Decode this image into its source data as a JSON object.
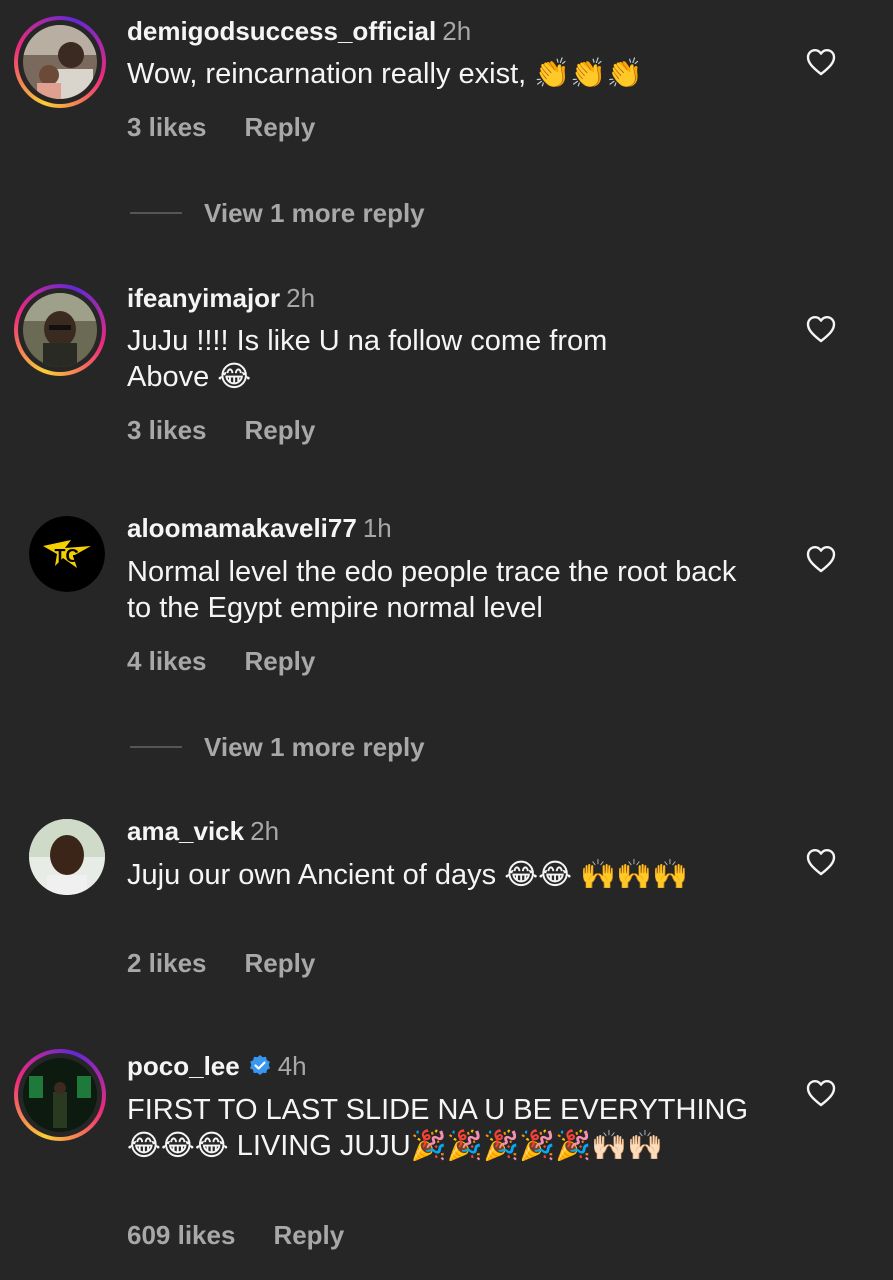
{
  "comments": [
    {
      "username": "demigodsuccess_official",
      "time": "2h",
      "text": "Wow, reincarnation really exist, 👏👏👏",
      "likes": "3 likes",
      "reply": "Reply",
      "view_more": "View 1 more reply"
    },
    {
      "username": "ifeanyimajor",
      "time": "2h",
      "text": "JuJu !!!! Is like U na follow come from Above 😂",
      "likes": "3 likes",
      "reply": "Reply"
    },
    {
      "username": "aloomamakaveli77",
      "time": "1h",
      "text": "Normal level the edo people trace the root back to the Egypt empire normal level",
      "likes": "4 likes",
      "reply": "Reply",
      "view_more": "View 1 more reply"
    },
    {
      "username": "ama_vick",
      "time": "2h",
      "text": "Juju our own Ancient of days 😂😂 🙌🙌🙌",
      "likes": "2 likes",
      "reply": "Reply"
    },
    {
      "username": "poco_lee",
      "time": "4h",
      "verified": true,
      "text": "FIRST TO LAST SLIDE NA U BE EVERYTHING 😂😂😂 LIVING JUJU🎉🎉🎉🎉🎉🙌🏻🙌🏻",
      "likes": "609 likes",
      "reply": "Reply"
    }
  ],
  "colors": {
    "background": "#262626",
    "primary_text": "#f5f5f5",
    "secondary_text": "#a8a8a8",
    "verified_badge": "#3897f0"
  }
}
